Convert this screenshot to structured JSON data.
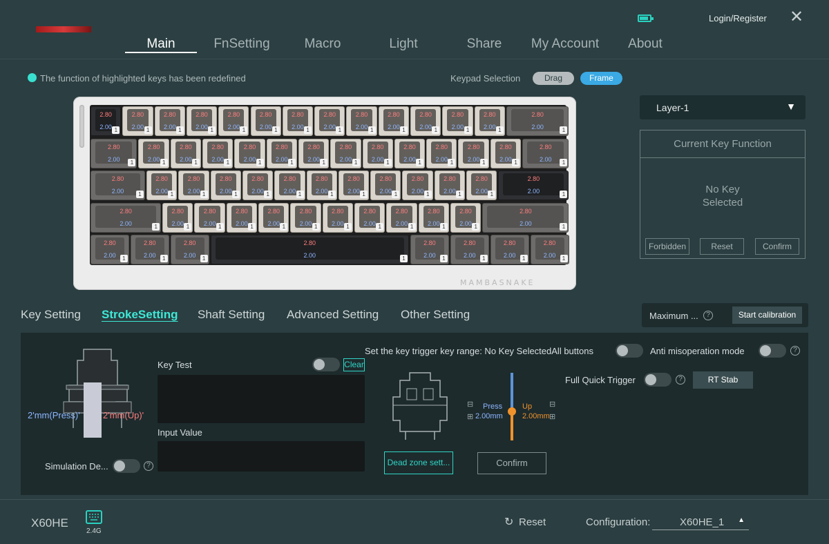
{
  "nav": {
    "tabs": [
      "Main",
      "FnSetting",
      "Macro",
      "Light",
      "Share",
      "My Account",
      "About"
    ],
    "active": "Main",
    "login": "Login/Register",
    "icons": {
      "battery": "battery-icon",
      "close": "close-icon"
    }
  },
  "notice": "The function of highlighted keys has been redefined",
  "keypad": {
    "label": "Keypad Selection",
    "drag": "Drag",
    "frame": "Frame"
  },
  "keyboard": {
    "brand": "MAMBASNAKE",
    "press_default": "2.80",
    "release_default": "2.00",
    "layer_badge": "1"
  },
  "layer": {
    "selected": "Layer-1"
  },
  "key_function": {
    "title": "Current Key Function",
    "empty_line1": "No Key",
    "empty_line2": "Selected",
    "buttons": [
      "Forbidden",
      "Reset",
      "Confirm"
    ]
  },
  "setting_tabs": [
    "Key Setting",
    "StrokeSetting",
    "Shaft Setting",
    "Advanced Setting",
    "Other Setting"
  ],
  "calibration": {
    "label": "Maximum ...",
    "button": "Start calibration"
  },
  "stroke": {
    "press_label": "2'mm(Press)'",
    "up_label": "2'mm(Up)'",
    "key_test": "Key Test",
    "clear": "Clear",
    "input_value": "Input Value",
    "simulation": "Simulation De...",
    "trigger_range": "Set the key trigger key range: No Key SelectedAll buttons",
    "anti": "Anti misoperation mode",
    "full_quick": "Full Quick Trigger",
    "rt_stab": "RT Stab",
    "press": "Press",
    "press_value": "2.00mm",
    "up": "Up",
    "up_value": "2.00mm",
    "dead_zone": "Dead zone sett...",
    "confirm": "Confirm"
  },
  "footer": {
    "model": "X60HE",
    "connection": "2.4G",
    "reset": "Reset",
    "config_label": "Configuration:",
    "config_value": "X60HE_1"
  },
  "colors": {
    "accent": "#3ee8d6",
    "frame_pill": "#3aa9e4",
    "press_value": "#ff7e7e",
    "release_value": "#8eb6ff",
    "up_orange": "#f0922b"
  }
}
